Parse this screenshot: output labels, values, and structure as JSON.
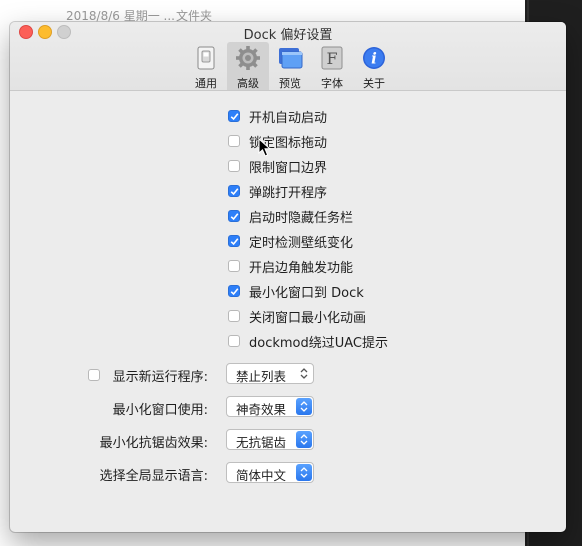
{
  "background": {
    "file_date": "2018/8/6 星期一 ...",
    "file_kind": "文件夹"
  },
  "window": {
    "title": "Dock 偏好设置",
    "toolbar": [
      {
        "label": "通用",
        "icon": "switch-icon",
        "selected": false
      },
      {
        "label": "高级",
        "icon": "gear-icon",
        "selected": true
      },
      {
        "label": "预览",
        "icon": "window-preview-icon",
        "selected": false
      },
      {
        "label": "字体",
        "icon": "font-icon",
        "selected": false
      },
      {
        "label": "关于",
        "icon": "info-icon",
        "selected": false
      }
    ],
    "options": [
      {
        "label": "开机自动启动",
        "checked": true
      },
      {
        "label": "锁定图标拖动",
        "checked": false
      },
      {
        "label": "限制窗口边界",
        "checked": false
      },
      {
        "label": "弹跳打开程序",
        "checked": true
      },
      {
        "label": "启动时隐藏任务栏",
        "checked": true
      },
      {
        "label": "定时检测壁纸变化",
        "checked": true
      },
      {
        "label": "开启边角触发功能",
        "checked": false
      },
      {
        "label": "最小化窗口到 Dock",
        "checked": true
      },
      {
        "label": "关闭窗口最小化动画",
        "checked": false
      },
      {
        "label": "dockmod绕过UAC提示",
        "checked": false
      }
    ],
    "settings": [
      {
        "label": "显示新运行程序:",
        "value": "禁止列表",
        "has_checkbox": true,
        "checked": false,
        "style": "plain"
      },
      {
        "label": "最小化窗口使用:",
        "value": "神奇效果",
        "has_checkbox": false,
        "style": "blue"
      },
      {
        "label": "最小化抗锯齿效果:",
        "value": "无抗锯齿",
        "has_checkbox": false,
        "style": "blue"
      },
      {
        "label": "选择全局显示语言:",
        "value": "简体中文",
        "has_checkbox": false,
        "style": "blue"
      }
    ]
  },
  "colors": {
    "accent": "#2d7ff9",
    "window_bg": "#ececec",
    "close": "#fc5f57",
    "minimize": "#fdbc2e"
  }
}
